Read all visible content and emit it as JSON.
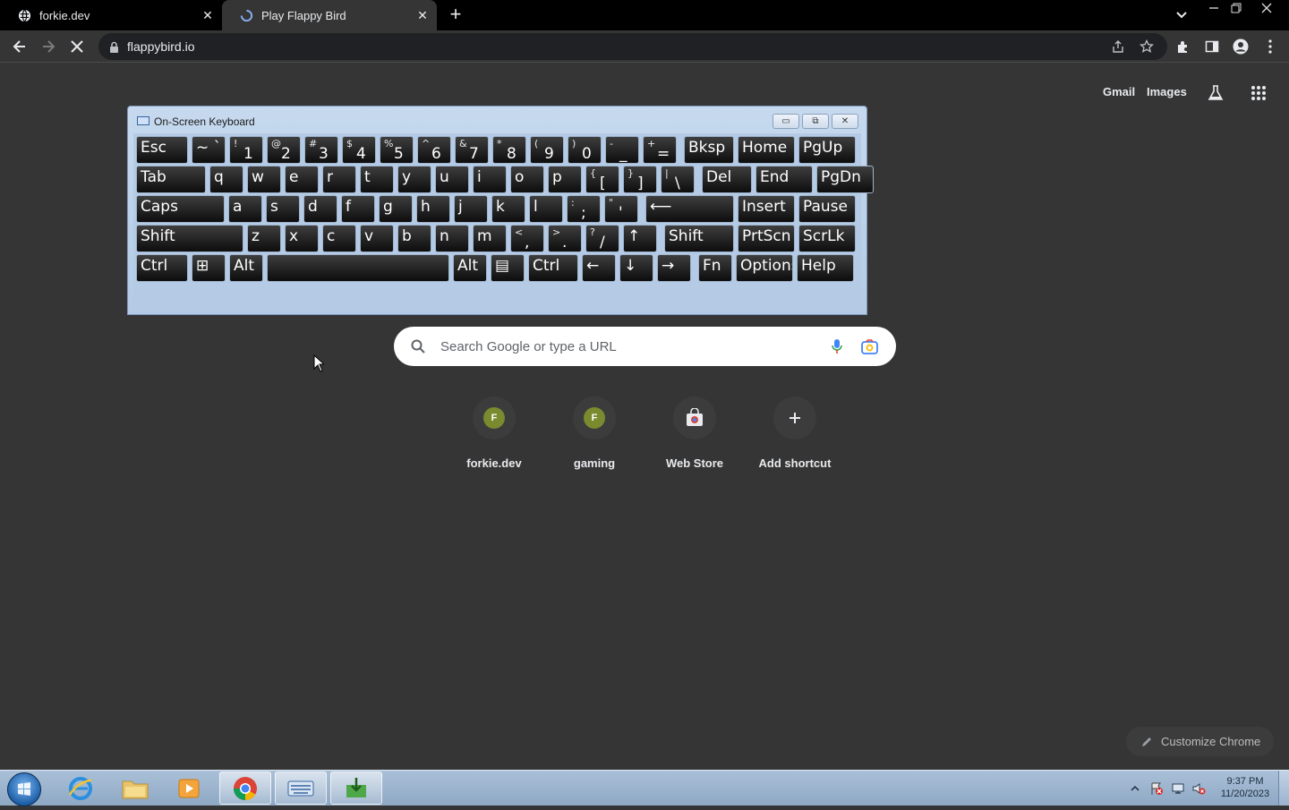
{
  "browser": {
    "tabs": [
      {
        "title": "forkie.dev"
      },
      {
        "title": "Play Flappy Bird"
      }
    ],
    "url": "flappybird.io"
  },
  "ntp": {
    "links": {
      "gmail": "Gmail",
      "images": "Images"
    },
    "search_placeholder": "Search Google or type a URL",
    "shortcuts": [
      {
        "label": "forkie.dev",
        "letter": "F"
      },
      {
        "label": "gaming",
        "letter": "F"
      },
      {
        "label": "Web Store"
      },
      {
        "label": "Add shortcut"
      }
    ],
    "customize_label": "Customize Chrome"
  },
  "osk": {
    "title": "On-Screen Keyboard",
    "rows": [
      [
        {
          "main": "Esc"
        },
        {
          "main": "~ `"
        },
        {
          "sec": "!",
          "pri": "1"
        },
        {
          "sec": "@",
          "pri": "2"
        },
        {
          "sec": "#",
          "pri": "3"
        },
        {
          "sec": "$",
          "pri": "4"
        },
        {
          "sec": "%",
          "pri": "5"
        },
        {
          "sec": "^",
          "pri": "6"
        },
        {
          "sec": "&",
          "pri": "7"
        },
        {
          "sec": "*",
          "pri": "8"
        },
        {
          "sec": "(",
          "pri": "9"
        },
        {
          "sec": ")",
          "pri": "0"
        },
        {
          "sec": "-",
          "pri": "_"
        },
        {
          "sec": "+",
          "pri": "="
        },
        {
          "main": "Bksp"
        },
        {
          "main": "Home"
        },
        {
          "main": "PgUp"
        }
      ],
      [
        {
          "main": "Tab"
        },
        {
          "main": "q"
        },
        {
          "main": "w"
        },
        {
          "main": "e"
        },
        {
          "main": "r"
        },
        {
          "main": "t"
        },
        {
          "main": "y"
        },
        {
          "main": "u"
        },
        {
          "main": "i"
        },
        {
          "main": "o"
        },
        {
          "main": "p"
        },
        {
          "sec": "{",
          "pri": "["
        },
        {
          "sec": "}",
          "pri": "]"
        },
        {
          "sec": "|",
          "pri": "\\"
        },
        {
          "main": "Del"
        },
        {
          "main": "End"
        },
        {
          "main": "PgDn"
        }
      ],
      [
        {
          "main": "Caps"
        },
        {
          "main": "a"
        },
        {
          "main": "s"
        },
        {
          "main": "d"
        },
        {
          "main": "f"
        },
        {
          "main": "g"
        },
        {
          "main": "h"
        },
        {
          "main": "j"
        },
        {
          "main": "k"
        },
        {
          "main": "l"
        },
        {
          "sec": ":",
          "pri": ";"
        },
        {
          "sec": "\"",
          "pri": "'"
        },
        {
          "main": "⟵"
        },
        {
          "main": "Insert"
        },
        {
          "main": "Pause"
        }
      ],
      [
        {
          "main": "Shift"
        },
        {
          "main": "z"
        },
        {
          "main": "x"
        },
        {
          "main": "c"
        },
        {
          "main": "v"
        },
        {
          "main": "b"
        },
        {
          "main": "n"
        },
        {
          "main": "m"
        },
        {
          "sec": "<",
          "pri": ","
        },
        {
          "sec": ">",
          "pri": "."
        },
        {
          "sec": "?",
          "pri": "/"
        },
        {
          "main": "↑"
        },
        {
          "main": "Shift"
        },
        {
          "main": "PrtScn"
        },
        {
          "main": "ScrLk"
        }
      ],
      [
        {
          "main": "Ctrl"
        },
        {
          "main": "⊞"
        },
        {
          "main": "Alt"
        },
        {
          "main": ""
        },
        {
          "main": "Alt"
        },
        {
          "main": "▤"
        },
        {
          "main": "Ctrl"
        },
        {
          "main": "←"
        },
        {
          "main": "↓"
        },
        {
          "main": "→"
        },
        {
          "main": "Fn"
        },
        {
          "main": "Options"
        },
        {
          "main": "Help"
        }
      ]
    ]
  },
  "taskbar": {
    "clock_time": "9:37 PM",
    "clock_date": "11/20/2023"
  }
}
